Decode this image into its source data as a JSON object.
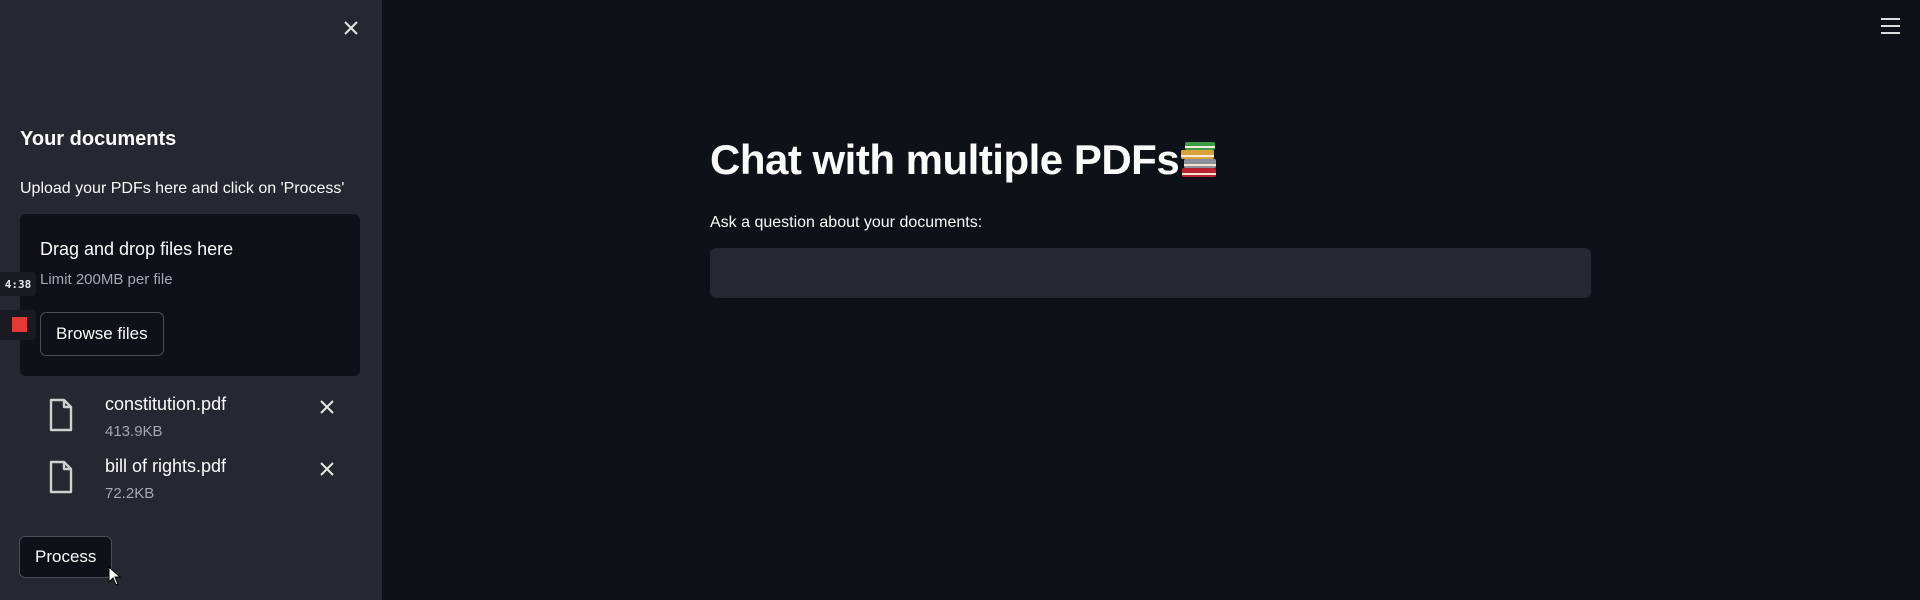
{
  "sidebar": {
    "title": "Your documents",
    "description": "Upload your PDFs here and click on 'Process'",
    "dropzone": {
      "title": "Drag and drop files here",
      "limit": "Limit 200MB per file",
      "browse_label": "Browse files"
    },
    "files": [
      {
        "name": "constitution.pdf",
        "size": "413.9KB"
      },
      {
        "name": "bill of rights.pdf",
        "size": "72.2KB"
      }
    ],
    "process_label": "Process"
  },
  "main": {
    "title": "Chat with multiple PDFs",
    "title_icon": "books-icon",
    "question_label": "Ask a question about your documents:",
    "question_value": "",
    "question_placeholder": ""
  },
  "overlay": {
    "timer": "4:38"
  },
  "icons": {
    "sidebar_close": "close-icon",
    "menu": "hamburger-menu-icon",
    "file": "file-icon",
    "remove": "close-icon"
  },
  "colors": {
    "background": "#0e1117",
    "sidebar": "#262730",
    "input_background": "#262730",
    "text": "#fafafa",
    "muted_text": "#a3a8b4",
    "record": "#e53935"
  }
}
